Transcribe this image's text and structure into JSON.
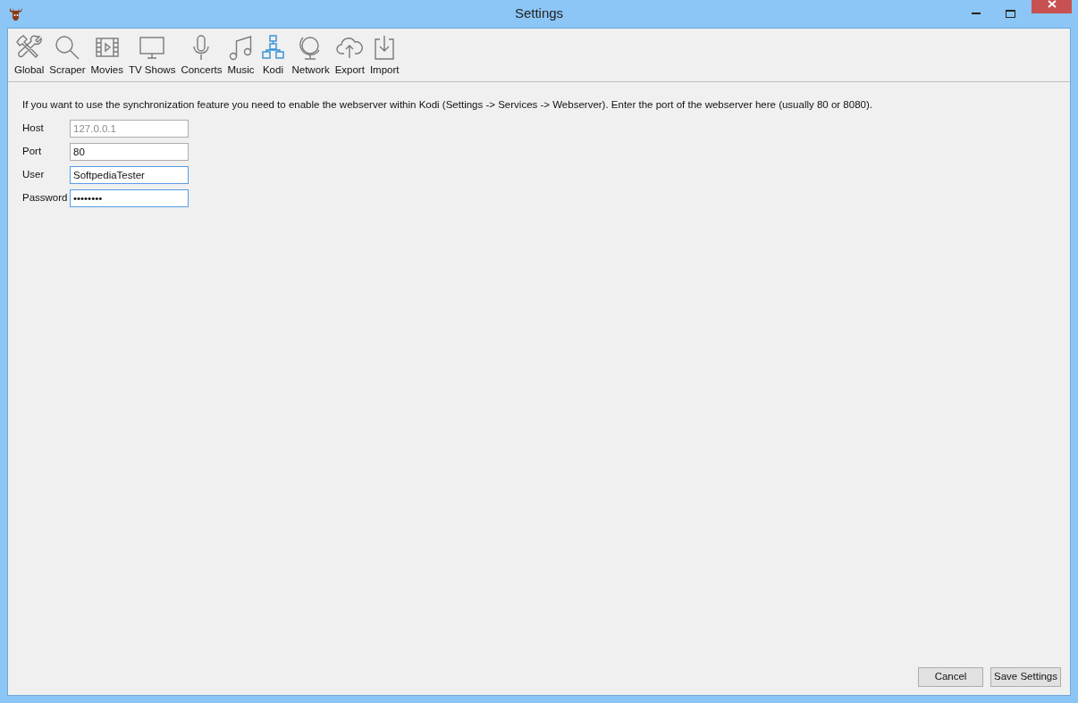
{
  "window": {
    "title": "Settings"
  },
  "toolbar": [
    {
      "label": "Global",
      "kind": "tools",
      "selected": false
    },
    {
      "label": "Scraper",
      "kind": "search",
      "selected": false
    },
    {
      "label": "Movies",
      "kind": "film",
      "selected": false
    },
    {
      "label": "TV Shows",
      "kind": "tv",
      "selected": false
    },
    {
      "label": "Concerts",
      "kind": "mic",
      "selected": false
    },
    {
      "label": "Music",
      "kind": "note",
      "selected": false
    },
    {
      "label": "Kodi",
      "kind": "network",
      "selected": true
    },
    {
      "label": "Network",
      "kind": "globe",
      "selected": false
    },
    {
      "label": "Export",
      "kind": "cloud",
      "selected": false
    },
    {
      "label": "Import",
      "kind": "import",
      "selected": false
    }
  ],
  "info": "If you want to use the synchronization feature you need to enable the webserver within Kodi (Settings -> Services -> Webserver). Enter the port of the webserver here (usually 80 or 8080).",
  "fields": [
    {
      "label": "Host",
      "value": "127.0.0.1",
      "disabled": true
    },
    {
      "label": "Port",
      "value": "80",
      "disabled": false
    },
    {
      "label": "User",
      "value": "SoftpediaTester",
      "disabled": false
    },
    {
      "label": "Password",
      "value": "••••••••",
      "disabled": false
    }
  ],
  "buttons": [
    "Cancel",
    "Save Settings"
  ]
}
